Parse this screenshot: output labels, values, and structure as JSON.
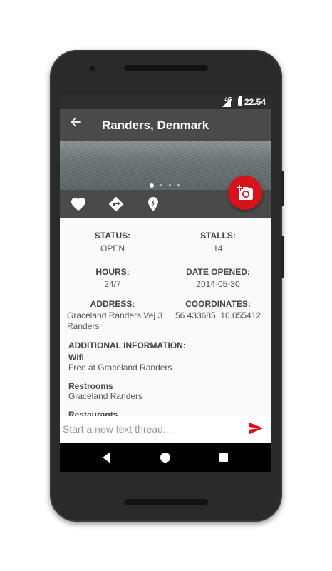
{
  "status_bar": {
    "network": "4G",
    "time": "22.54"
  },
  "app_bar": {
    "back_icon": "arrow-left-icon",
    "title": "Randers, Denmark"
  },
  "gallery": {
    "image_count": 4,
    "active_index": 0
  },
  "actions": {
    "favorite_icon": "heart-icon",
    "directions_icon": "directions-icon",
    "checkin_icon": "pin-bolt-icon",
    "photo_button_icon": "add-photo-camera-icon"
  },
  "details": {
    "status_label": "STATUS:",
    "status_value": "OPEN",
    "stalls_label": "STALLS:",
    "stalls_value": "14",
    "hours_label": "HOURS:",
    "hours_value": "24/7",
    "date_opened_label": "DATE OPENED:",
    "date_opened_value": "2014-05-30",
    "address_label": "ADDRESS:",
    "address_line1": "Graceland Randers Vej 3",
    "address_line2": "Randers",
    "coordinates_label": "COORDINATES:",
    "coordinates_value": "56.433685, 10.055412"
  },
  "additional": {
    "heading": "ADDITIONAL INFORMATION:",
    "items": [
      {
        "title": "Wifi",
        "value": "Free at Graceland Randers"
      },
      {
        "title": "Restrooms",
        "value": "Graceland Randers"
      },
      {
        "title": "Restaurants",
        "value": ""
      }
    ]
  },
  "composer": {
    "placeholder": "Start a new text thread...",
    "send_icon": "send-icon"
  },
  "nav_bar": {
    "back_icon": "nav-back-icon",
    "home_icon": "nav-home-icon",
    "recents_icon": "nav-recents-icon"
  },
  "colors": {
    "accent": "#d8121a",
    "toolbar": "#4a4a4a",
    "status_bar": "#2e2e2e",
    "background": "#fafafa"
  }
}
